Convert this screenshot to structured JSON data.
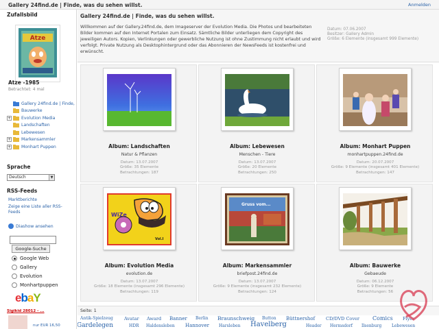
{
  "topbar": {
    "title": "Gallery 24find.de | Finde, was du sehen willst.",
    "login": "Anmelden"
  },
  "sidebar": {
    "random_heading": "Zufallsbild",
    "random_image_title": "Atze -1985",
    "random_image_views": "Betrachtet: 4 mal",
    "tree": [
      {
        "label": "Gallery 24find.de | Finde,",
        "expander": "",
        "level": 0
      },
      {
        "label": "Bauwerke",
        "expander": "",
        "level": 1
      },
      {
        "label": "Evolution Media",
        "expander": "+",
        "level": 1
      },
      {
        "label": "Landschaften",
        "expander": "",
        "level": 1
      },
      {
        "label": "Lebewesen",
        "expander": "",
        "level": 1
      },
      {
        "label": "Markensammler",
        "expander": "+",
        "level": 1
      },
      {
        "label": "Monhart Puppen",
        "expander": "+",
        "level": 1
      }
    ],
    "language_heading": "Sprache",
    "language_value": "Deutsch",
    "rss_heading": "RSS-Feeds",
    "rss_links": [
      "Marktberichte",
      "Zeige eine Liste aller RSS-Feeds"
    ],
    "slideshow_label": "Diashow ansehen",
    "search_button": "Google-Suche",
    "search_options": [
      {
        "label": "Google Web",
        "checked": true
      },
      {
        "label": "Gallery",
        "checked": false
      },
      {
        "label": "Evolution",
        "checked": false
      },
      {
        "label": "Monhartpuppen",
        "checked": false
      }
    ],
    "ebay_item": "Sigikid 28012 - ...",
    "ebay_price": "nur EUR 16,50"
  },
  "intro": {
    "title": "Gallery 24find.de | Finde, was du sehen willst.",
    "text": "Willkommen auf der Gallery.24find.de, dem Imageserver der Evolution Media. Die Photos und bearbeiteten Bilder kommen auf den Internet Portalen zum Einsatz. Sämtliche Bilder unterliegen dem Copyright des jeweiligen Autors. Kopien, Verlinkungen oder gewerbliche Nutzung ist ohne Zustimmung nicht erlaubt und wird verfolgt. Private Nutzung als Desktophintergrund oder das Abonnieren der NewsFeeds ist kostenfrei und erwünscht.",
    "meta": [
      "Datum: 07.06.2007",
      "Besitzer: Gallery Admin",
      "Größe: 6 Elemente (insgesamt 999 Elemente)"
    ]
  },
  "albums": [
    {
      "title": "Album: Landschaften",
      "desc": "Natur & Pflanzen",
      "date": "Datum: 13.07.2007",
      "size": "Größe: 35 Elemente",
      "views": "Betrachtungen: 187",
      "photo": "wind-turbines"
    },
    {
      "title": "Album: Lebewesen",
      "desc": "Menschen - Tiere",
      "date": "Datum: 13.07.2007",
      "size": "Größe: 20 Elemente",
      "views": "Betrachtungen: 250",
      "photo": "swan"
    },
    {
      "title": "Album: Monhart Puppen",
      "desc": "monhartpuppen.24find.de",
      "date": "Datum: 20.07.2007",
      "size": "Größe: 9 Elemente (insgesamt 401 Elemente)",
      "views": "Betrachtungen: 147",
      "photo": "dolls"
    },
    {
      "title": "Album: Evolution Media",
      "desc": "evolution.de",
      "date": "Datum: 13.07.2007",
      "size": "Größe: 18 Elemente (insgesamt 296 Elemente)",
      "views": "Betrachtungen: 119",
      "photo": "cartoon"
    },
    {
      "title": "Album: Markensammler",
      "desc": "briefpost.24find.de",
      "date": "Datum: 13.07.2007",
      "size": "Größe: 9 Elemente (insgesamt 232 Elemente)",
      "views": "Betrachtungen: 124",
      "photo": "stamp"
    },
    {
      "title": "Album: Bauwerke",
      "desc": "Gebaeude",
      "date": "Datum: 06.12.2007",
      "size": "Größe: 9 Elemente",
      "views": "Betrachtungen: 56",
      "photo": "pergola"
    }
  ],
  "pager": "Seite: 1",
  "tags": [
    "Antik-Spielzeug",
    "Avatar",
    "Award",
    "Banner",
    "Berlin",
    "Braunschweig",
    "Button",
    "Büttnershof",
    "CD/DVD Cover",
    "Comics",
    "Flyer",
    "Gardelegen",
    "HDR",
    "Haldensleben",
    "Hannover",
    "Harsleben",
    "Havelberg",
    "Header",
    "Hermsdorf",
    "Ilsenburg",
    "Lebewesen"
  ]
}
